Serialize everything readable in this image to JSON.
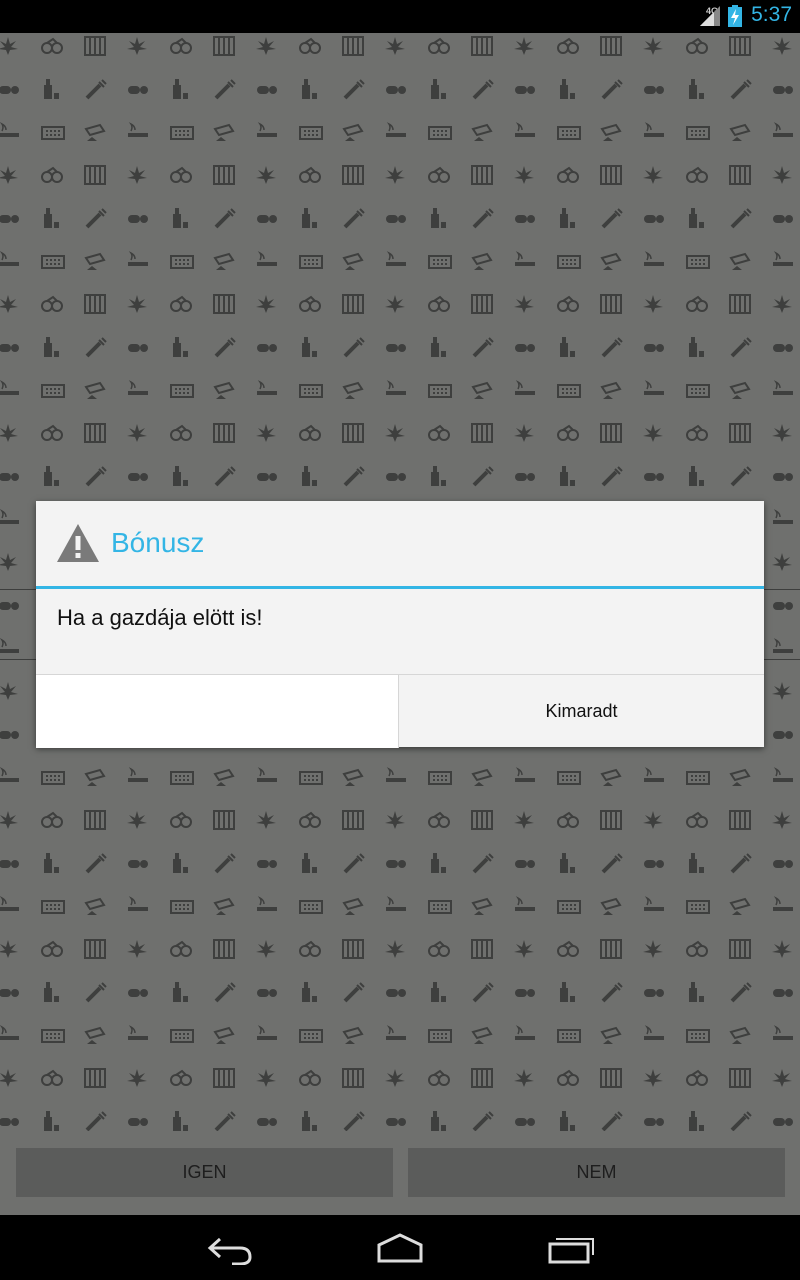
{
  "status_bar": {
    "network": "4G",
    "time": "5:37"
  },
  "dialog": {
    "title": "Bónusz",
    "title_icon": "warning-icon",
    "message": "Ha a gazdája elött is!",
    "left_button_label": "",
    "right_button_label": "Kimaradt"
  },
  "bottom_buttons": {
    "yes_label": "IGEN",
    "no_label": "NEM"
  },
  "colors": {
    "accent": "#33b5e5",
    "overlay_bg": "#6f706e",
    "pattern_icon": "#3e3f3e"
  },
  "navigation": {
    "back_icon": "back-icon",
    "home_icon": "home-icon",
    "recents_icon": "recents-icon"
  }
}
